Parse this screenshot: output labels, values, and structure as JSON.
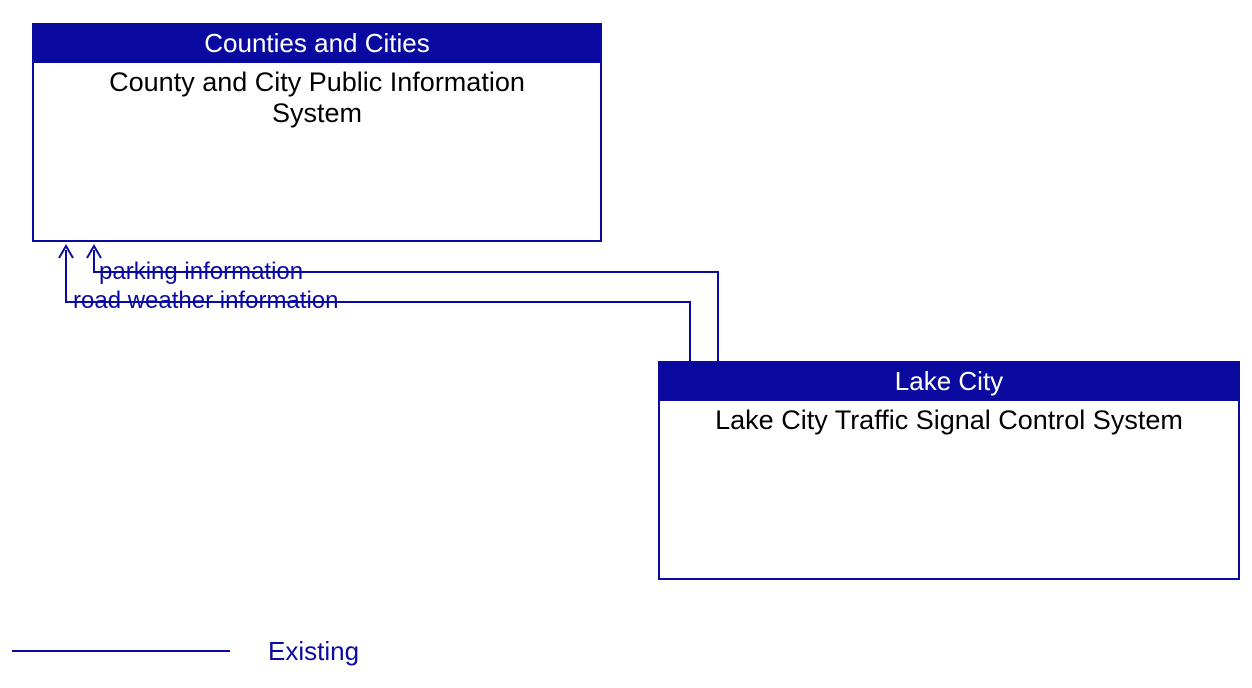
{
  "boxes": {
    "top": {
      "header": "Counties and Cities",
      "body_line1": "County and City Public Information",
      "body_line2": "System"
    },
    "bottom": {
      "header": "Lake City",
      "body": "Lake City Traffic Signal Control System"
    }
  },
  "flows": {
    "f1": "parking information",
    "f2": "road weather information"
  },
  "legend": {
    "existing": "Existing"
  },
  "colors": {
    "line": "#0a0aa0"
  }
}
